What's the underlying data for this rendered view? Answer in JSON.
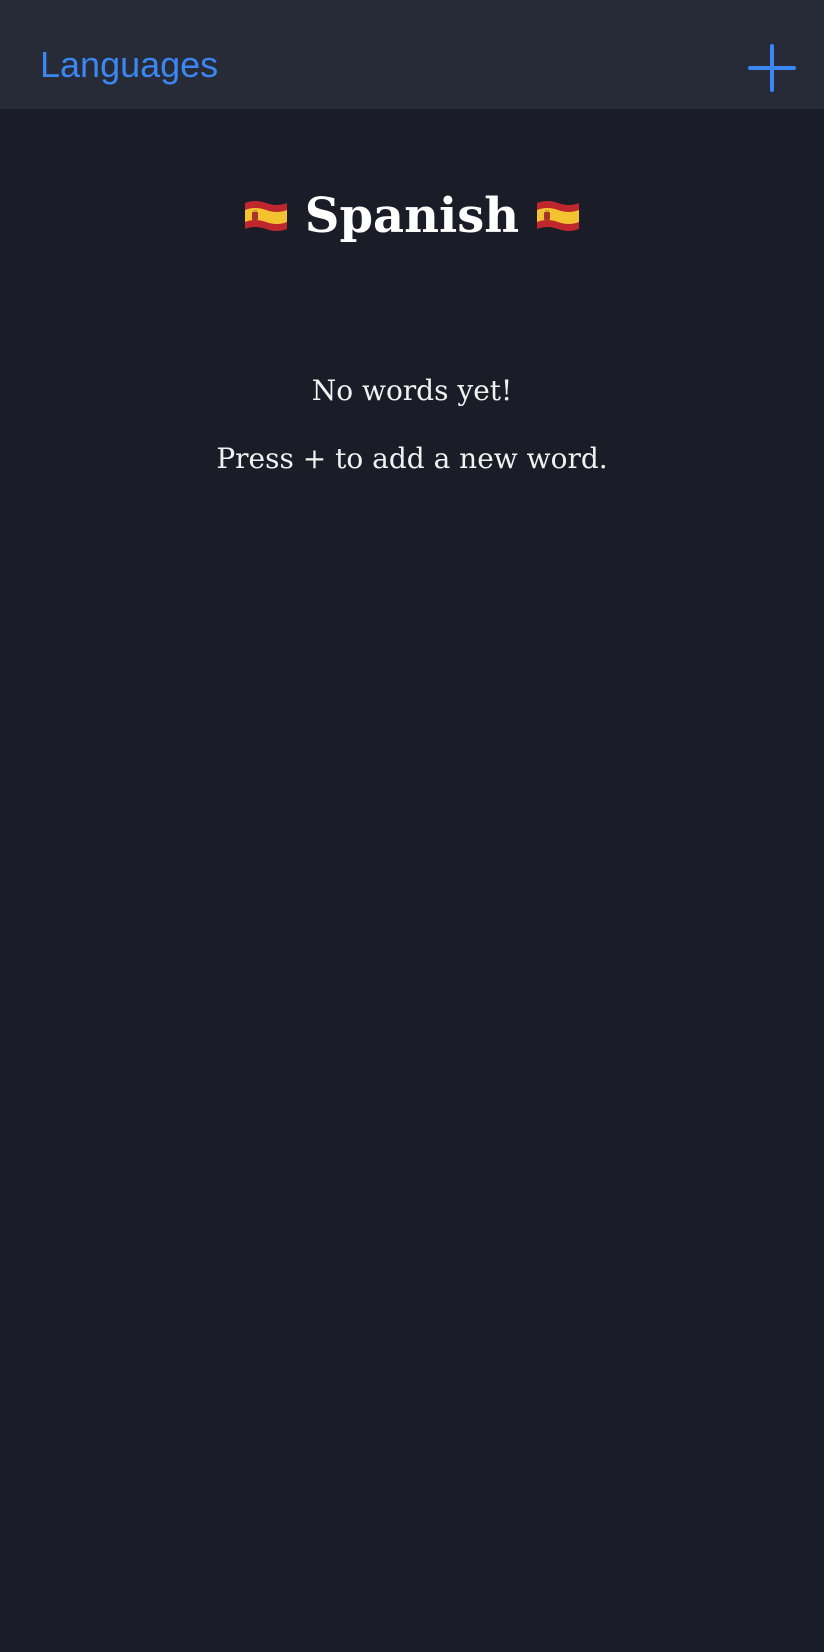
{
  "nav": {
    "back_label": "Languages",
    "add_icon": "plus-icon",
    "accent_color": "#3b86f0"
  },
  "header": {
    "flag_icon": "spain-flag-icon",
    "title": "Spanish"
  },
  "empty_state": {
    "message": "No words yet!",
    "hint": "Press + to add a new word."
  },
  "colors": {
    "background": "#1a1c27",
    "nav_background": "#272a37",
    "text": "#ffffff"
  }
}
